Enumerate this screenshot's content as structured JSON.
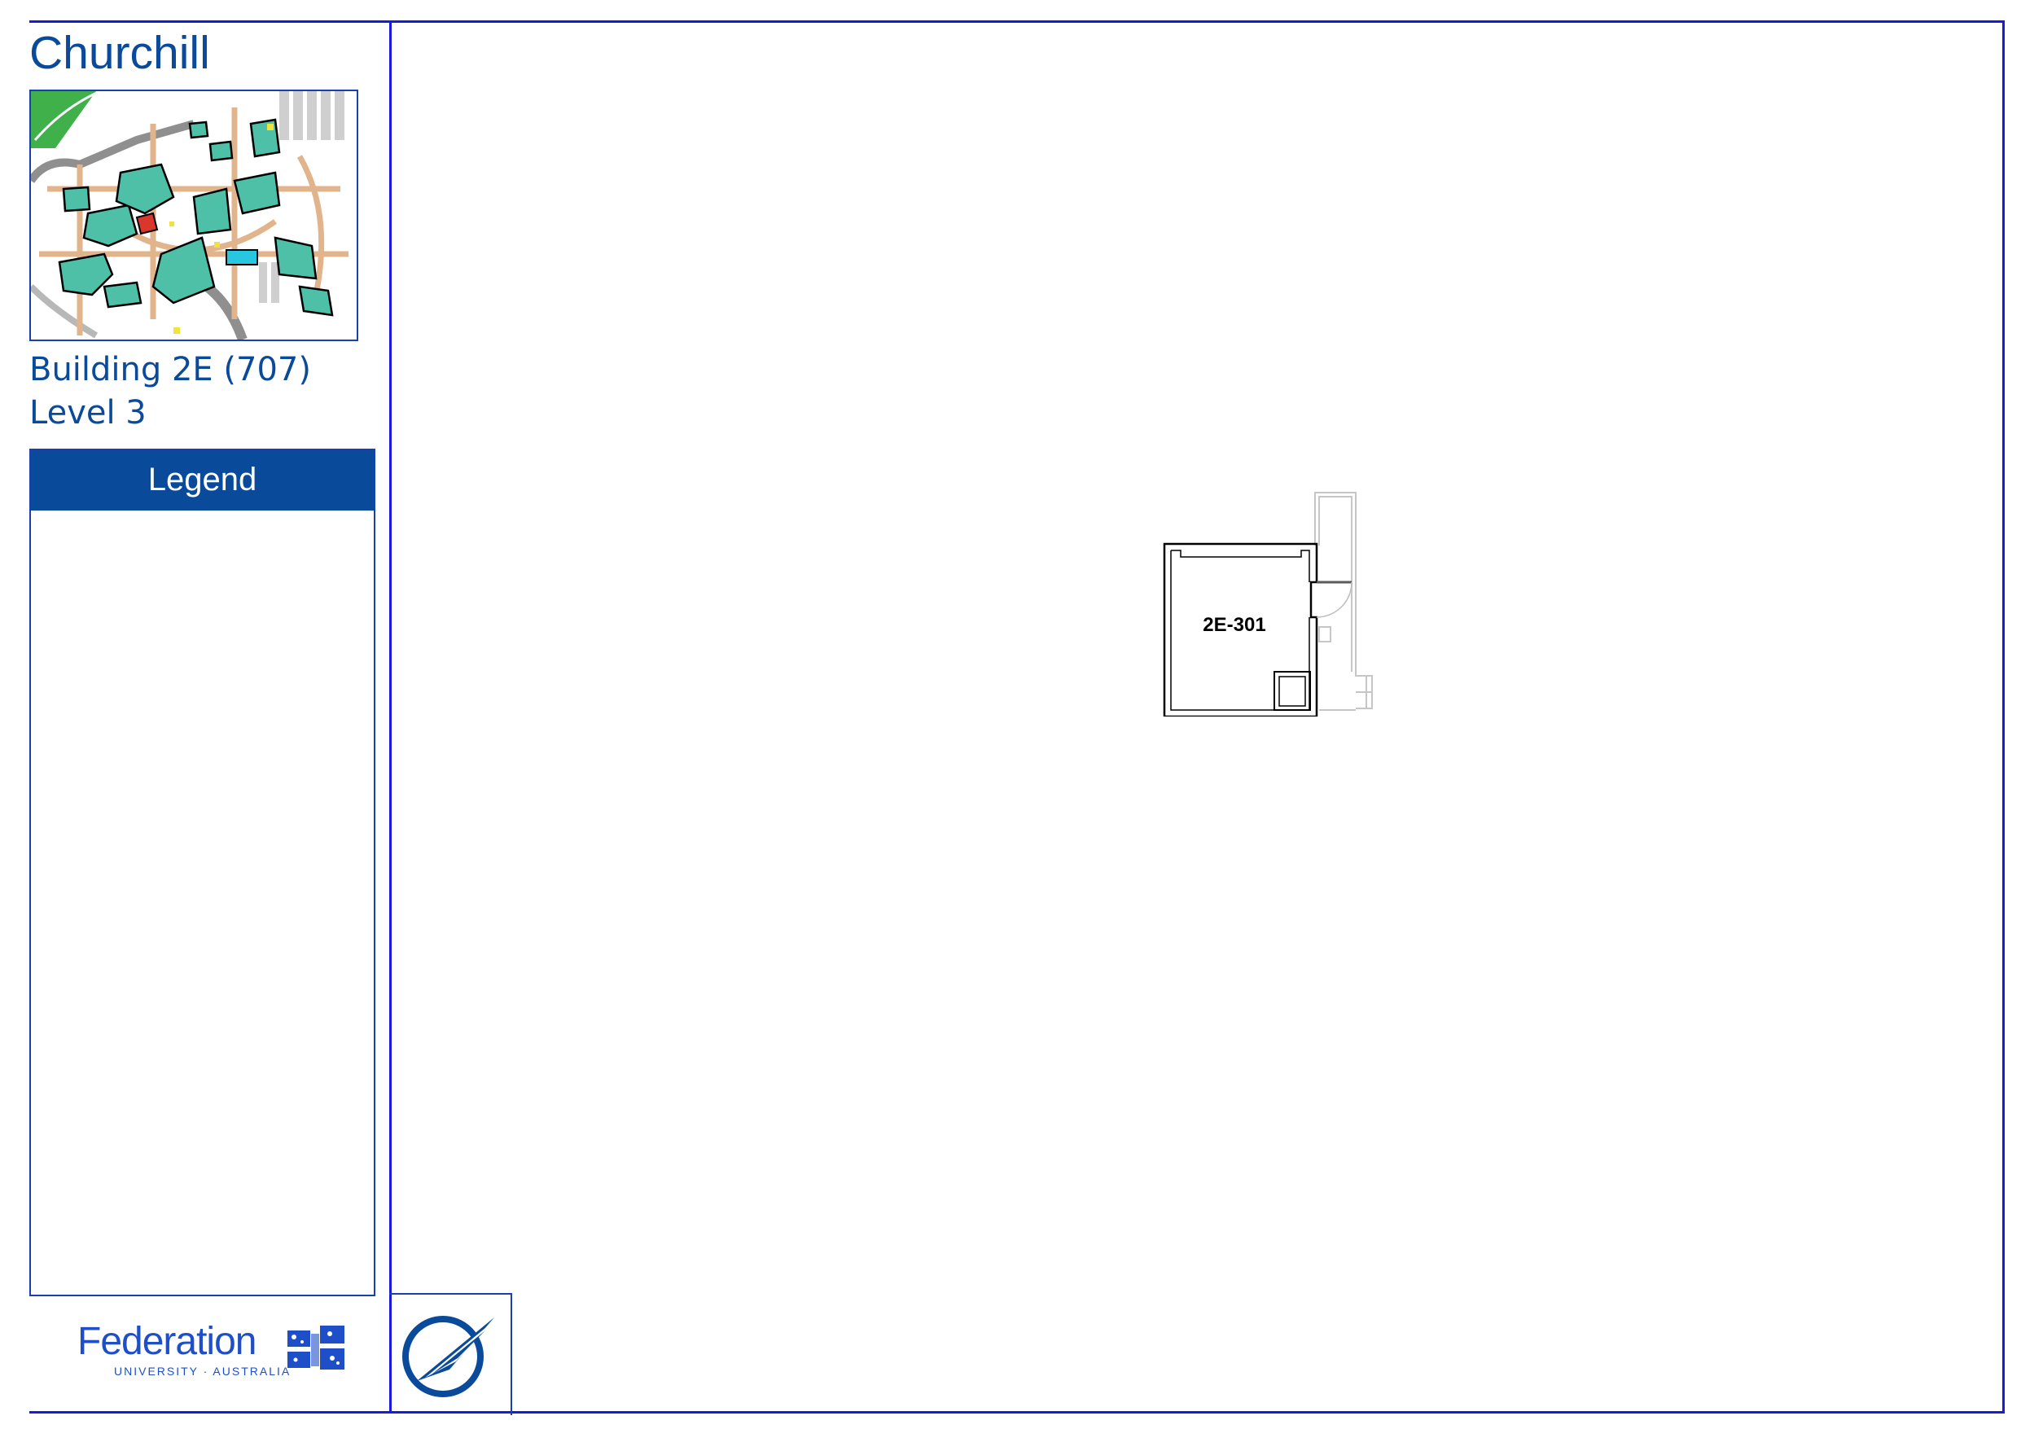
{
  "header": {
    "campus_name": "Churchill",
    "building_line": "Building 2E (707)",
    "level_line": "Level 3"
  },
  "legend": {
    "title": "Legend"
  },
  "plan": {
    "room_label": "2E-301"
  },
  "logo": {
    "wordmark": "Federation",
    "tagline": "UNIVERSITY · AUSTRALIA"
  },
  "colors": {
    "frame": "#1a1adb",
    "brand_blue": "#0a4a9a",
    "logo_blue": "#1f4fc8",
    "building_fill": "#4fc0a8",
    "path_fill": "#e2b48c",
    "highlight_building": "#d8372a",
    "grass": "#3fb04a"
  },
  "icons": {
    "north_arrow": "north-arrow-icon",
    "federation_flag": "federation-flag-icon"
  }
}
